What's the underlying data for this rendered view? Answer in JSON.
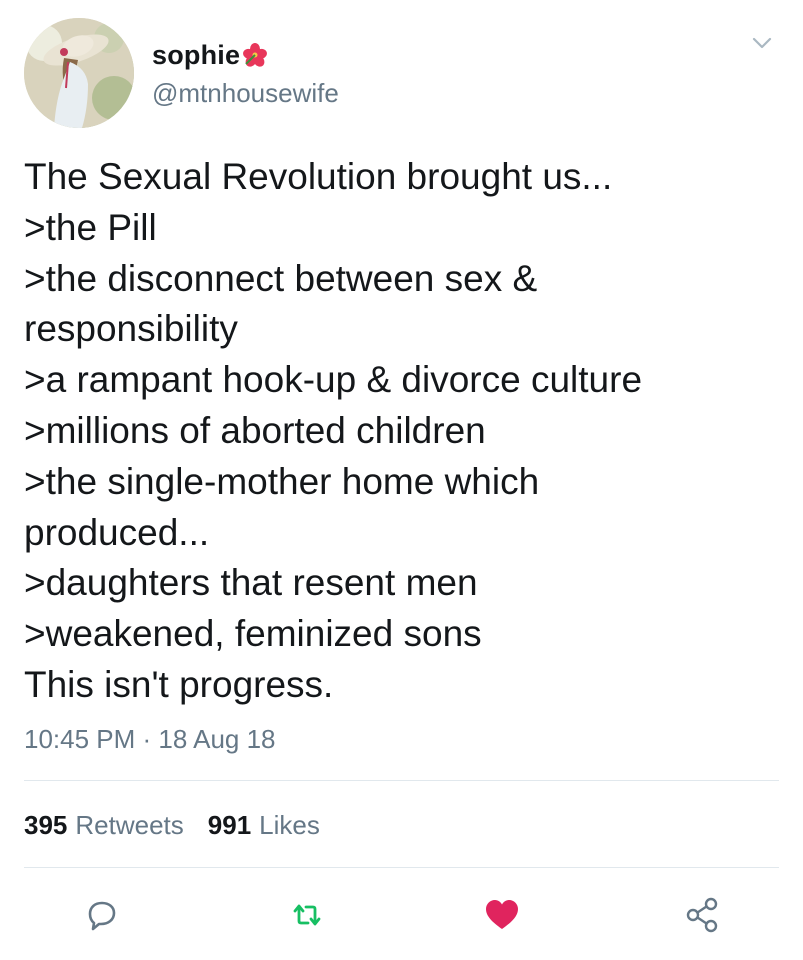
{
  "header": {
    "display_name": "sophie",
    "name_emoji": "hibiscus-emoji",
    "handle": "@mtnhousewife"
  },
  "tweet": {
    "lines": [
      "The Sexual Revolution brought us...",
      ">the Pill",
      ">the disconnect between sex &",
      "responsibility",
      ">a rampant hook-up & divorce culture",
      ">millions of aborted children",
      ">the single-mother home which",
      "produced...",
      ">daughters that resent men",
      ">weakened, feminized sons",
      "This isn't progress."
    ],
    "timestamp": "10:45 PM · 18 Aug 18"
  },
  "stats": {
    "retweets_count": "395",
    "retweets_label": "Retweets",
    "likes_count": "991",
    "likes_label": "Likes"
  },
  "actions": {
    "reply_icon": "reply-icon",
    "retweet_icon": "retweet-icon",
    "like_icon": "heart-icon",
    "share_icon": "share-icon"
  },
  "colors": {
    "text_primary": "#14171a",
    "text_secondary": "#657786",
    "divider": "#e1e8ed",
    "retweet_green": "#17bf63",
    "like_red": "#e0245e",
    "icon_gray": "#657786"
  }
}
